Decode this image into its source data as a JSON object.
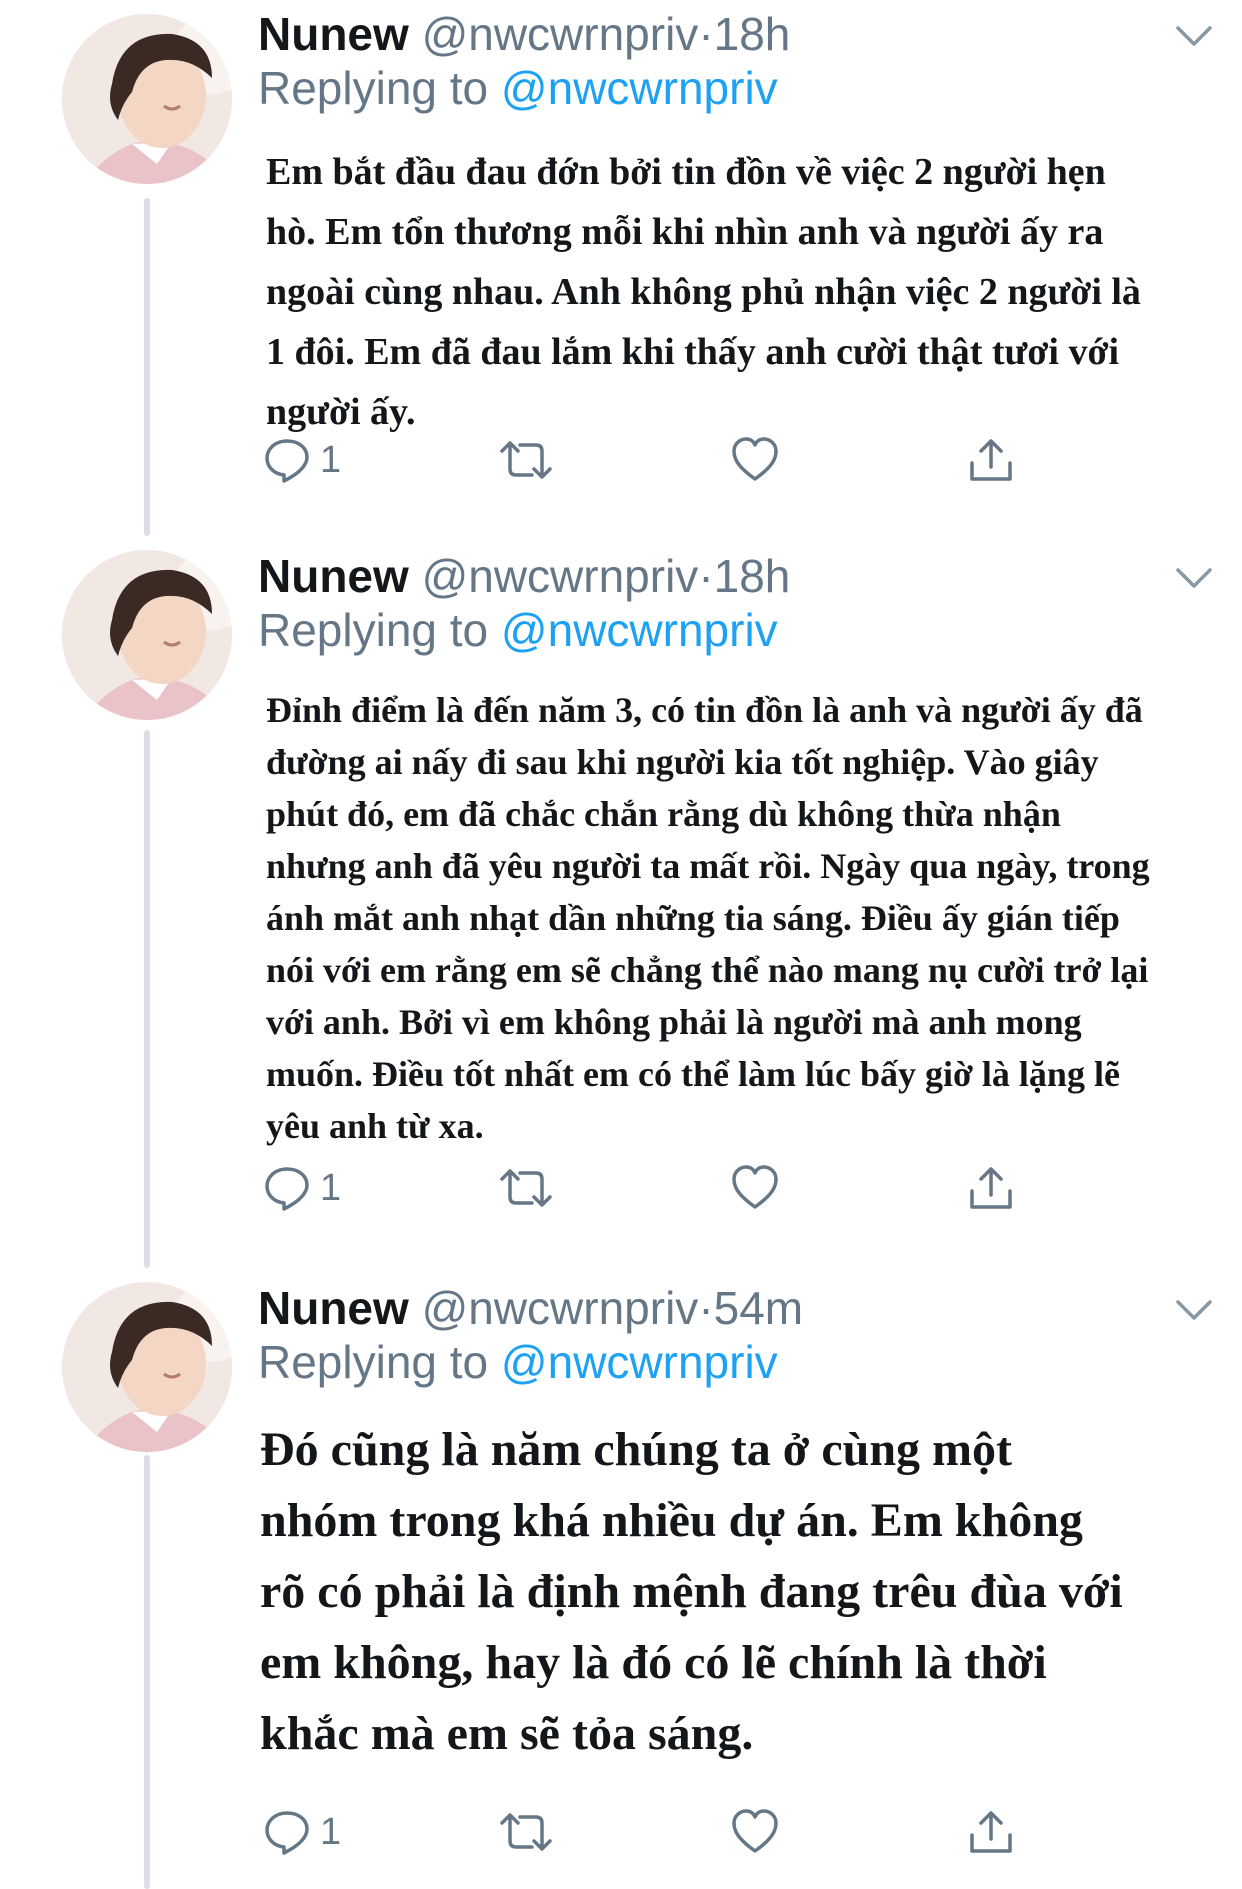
{
  "tweets": [
    {
      "name": "Nunew",
      "handle": "@nwcwrnpriv",
      "separator": "·",
      "time": "18h",
      "replying_prefix": "Replying to",
      "replying_to": "@nwcwrnpriv",
      "text": "Em bắt đầu đau đớn bởi tin đồn về việc 2 người hẹn hò. Em tổn thương mỗi khi nhìn anh và người ấy ra ngoài cùng nhau. Anh không phủ nhận việc 2 người là 1 đôi. Em đã đau lắm khi thấy anh cười thật tươi với người ấy.",
      "reply_count": "1"
    },
    {
      "name": "Nunew",
      "handle": "@nwcwrnpriv",
      "separator": "·",
      "time": "18h",
      "replying_prefix": "Replying to",
      "replying_to": "@nwcwrnpriv",
      "text": "Đỉnh điểm là đến năm 3, có tin đồn là anh và người ấy đã đường ai nấy đi sau khi người kia tốt nghiệp. Vào giây phút đó, em đã chắc chắn rằng dù không thừa nhận nhưng anh đã yêu người ta mất rồi. Ngày qua ngày, trong ánh mắt anh nhạt dần những tia sáng. Điều ấy gián tiếp nói với em rằng em sẽ chẳng thể nào mang nụ cười trở lại với anh. Bởi vì em không phải là người mà anh mong muốn. Điều tốt nhất em có thể làm lúc bấy giờ là lặng lẽ yêu anh từ xa.",
      "reply_count": "1"
    },
    {
      "name": "Nunew",
      "handle": "@nwcwrnpriv",
      "separator": "·",
      "time": "54m",
      "replying_prefix": "Replying to",
      "replying_to": "@nwcwrnpriv",
      "text": "Đó cũng là năm chúng ta ở cùng một nhóm trong khá nhiều dự án. Em không rõ có phải là định mệnh đang trêu đùa với em không, hay là đó có lẽ chính là thời khắc mà em sẽ tỏa sáng.",
      "reply_count": "1"
    }
  ],
  "icons": {
    "reply": "reply-icon",
    "retweet": "retweet-icon",
    "like": "heart-icon",
    "share": "share-icon",
    "caret": "chevron-down-icon"
  },
  "colors": {
    "text": "#14171a",
    "secondary": "#657786",
    "accent": "#1da1f2",
    "thread_line": "#d9dfe4"
  }
}
